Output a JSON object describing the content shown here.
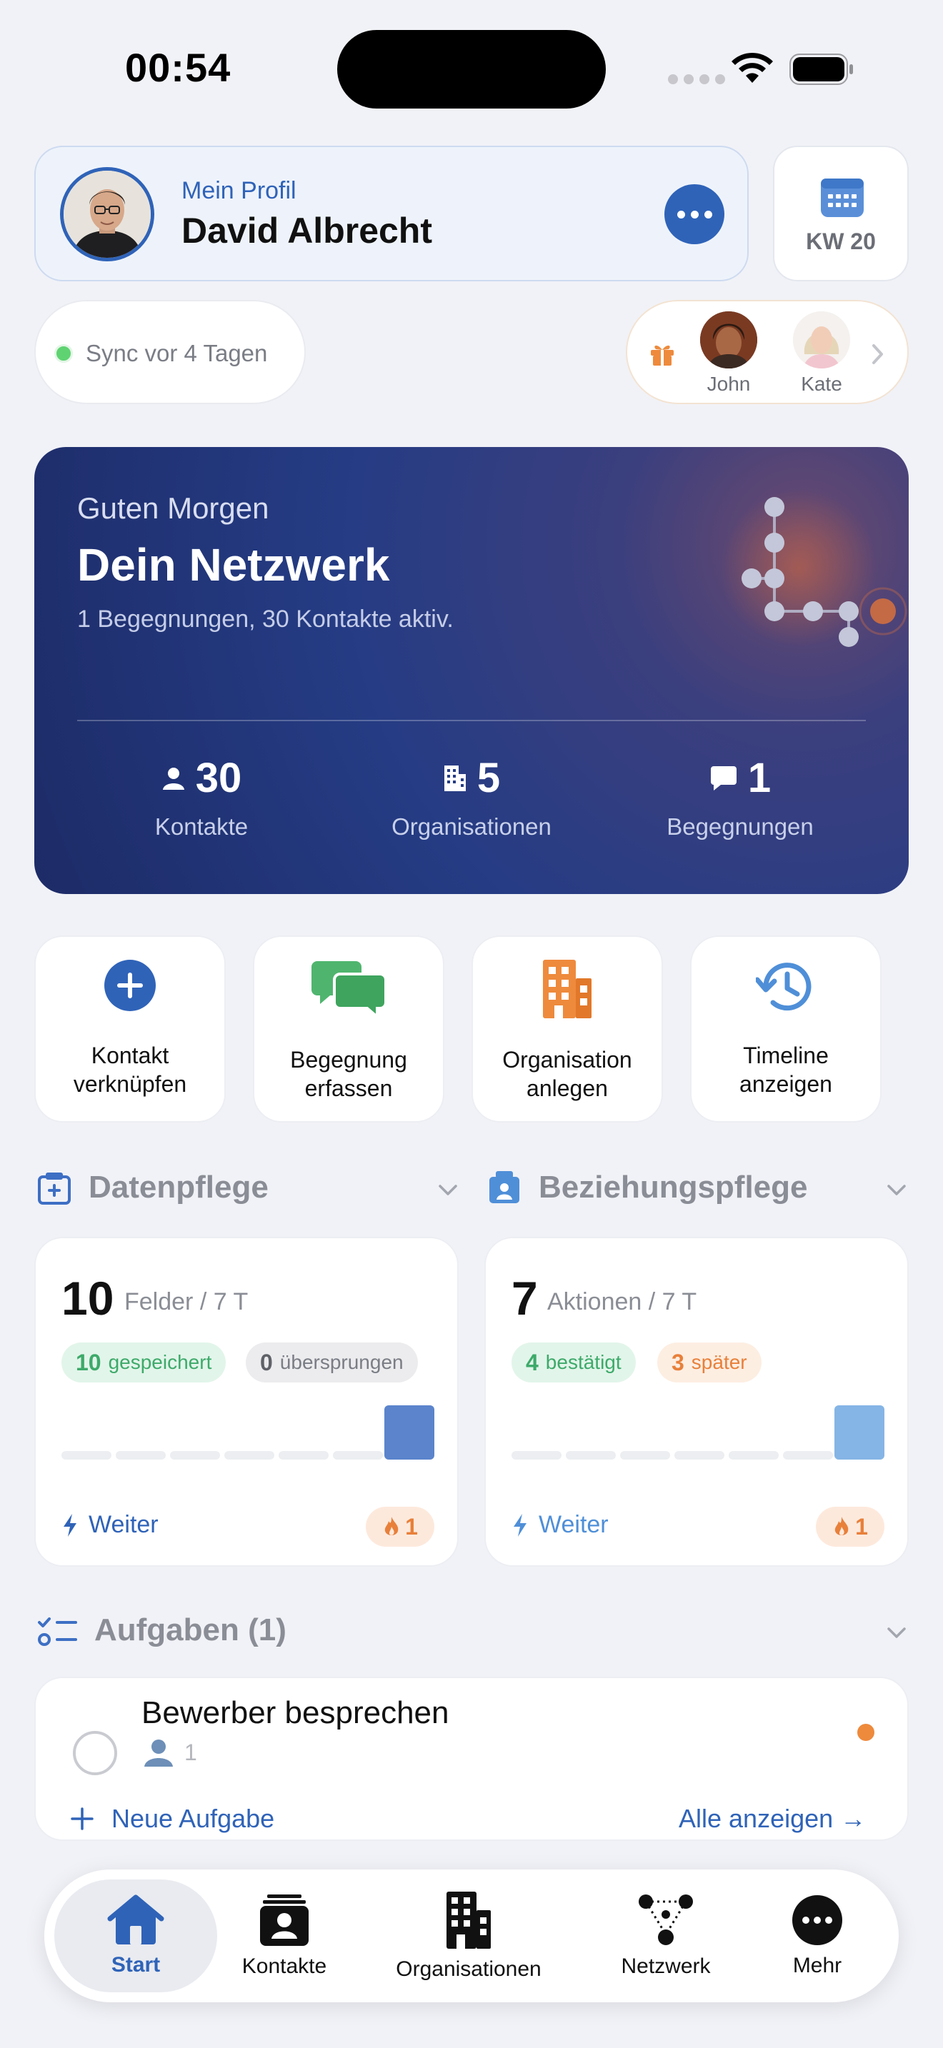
{
  "status_bar": {
    "time": "00:54"
  },
  "profile": {
    "label": "Mein Profil",
    "name": "David Albrecht"
  },
  "week": {
    "label": "KW 20"
  },
  "sync": {
    "text": "Sync vor 4 Tagen"
  },
  "birthdays": {
    "people": [
      {
        "name": "John"
      },
      {
        "name": "Kate"
      }
    ]
  },
  "hero": {
    "greeting": "Guten Morgen",
    "title": "Dein Netzwerk",
    "subtitle": "1 Begegnungen, 30 Kontakte aktiv.",
    "stats": [
      {
        "value": "30",
        "label": "Kontakte",
        "icon": "person-icon"
      },
      {
        "value": "5",
        "label": "Organisationen",
        "icon": "building-icon"
      },
      {
        "value": "1",
        "label": "Begegnungen",
        "icon": "chat-bubble-icon"
      }
    ]
  },
  "actions": [
    {
      "line1": "Kontakt",
      "line2": "verknüpfen",
      "icon": "plus-circle-icon"
    },
    {
      "line1": "Begegnung",
      "line2": "erfassen",
      "icon": "chat-bubbles-icon"
    },
    {
      "line1": "Organisation",
      "line2": "anlegen",
      "icon": "building-icon"
    },
    {
      "line1": "Timeline",
      "line2": "anzeigen",
      "icon": "history-clock-icon"
    }
  ],
  "sections": {
    "datenpflege": {
      "title": "Datenpflege",
      "value": "10",
      "unit": "Felder / 7 T",
      "chip1_value": "10",
      "chip1_label": "gespeichert",
      "chip2_value": "0",
      "chip2_label": "übersprungen",
      "action": "Weiter",
      "streak": "1",
      "color": "#5b84cc"
    },
    "beziehungspflege": {
      "title": "Beziehungspflege",
      "value": "7",
      "unit": "Aktionen / 7 T",
      "chip1_value": "4",
      "chip1_label": "bestätigt",
      "chip2_value": "3",
      "chip2_label": "später",
      "action": "Weiter",
      "streak": "1",
      "color": "#85b5e6"
    }
  },
  "tasks": {
    "title": "Aufgaben (1)",
    "items": [
      {
        "title": "Bewerber besprechen",
        "count": "1"
      }
    ],
    "new_label": "Neue Aufgabe",
    "all_label": "Alle anzeigen →"
  },
  "tabbar": {
    "items": [
      {
        "label": "Start",
        "icon": "house-icon",
        "active": true
      },
      {
        "label": "Kontakte",
        "icon": "contact-card-icon"
      },
      {
        "label": "Organisationen",
        "icon": "building-icon"
      },
      {
        "label": "Netzwerk",
        "icon": "network-graph-icon"
      },
      {
        "label": "Mehr",
        "icon": "more-circle-icon"
      }
    ]
  },
  "colors": {
    "accent": "#2f63b8",
    "orange": "#ee8a3c",
    "green": "#3daa6a"
  }
}
